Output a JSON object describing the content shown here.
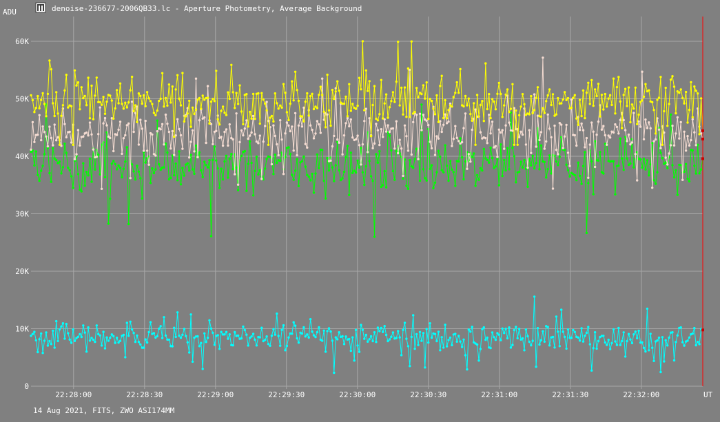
{
  "window": {
    "title": "denoise-236677-2006QB33.lc - Aperture Photometry, Average Background",
    "icon": "tiles-app-icon"
  },
  "footer": {
    "text": "14 Aug 2021, FITS, ZWO ASI174MM"
  },
  "colors": {
    "background": "#808080",
    "grid": "#a8a8a8",
    "text": "#ffffff",
    "cursor": "#ff0000",
    "series_yellow": "#ffff00",
    "series_pink": "#f5dcd2",
    "series_green": "#00ff00",
    "series_cyan": "#00ffff"
  },
  "chart_data": {
    "type": "line",
    "ylabel": "ADU",
    "xlabel": "UT",
    "ylim": [
      0,
      60000
    ],
    "y_ticks": [
      0,
      10000,
      20000,
      30000,
      40000,
      50000,
      60000
    ],
    "y_tick_labels": [
      "0",
      "10K",
      "20K",
      "30K",
      "40K",
      "50K",
      "60K"
    ],
    "xlim": [
      "22:27:42",
      "22:32:26"
    ],
    "x_ticks": [
      "22:28:00",
      "22:28:30",
      "22:29:00",
      "22:29:30",
      "22:30:00",
      "22:30:30",
      "22:31:00",
      "22:31:30",
      "22:32:00"
    ],
    "grid": true,
    "markers": true,
    "samples_per_series": 400,
    "cursor_x": "22:32:26",
    "series": [
      {
        "color": "yellow",
        "mean": 49500,
        "spread": 3800,
        "min": 42000,
        "max": 61500
      },
      {
        "color": "pink",
        "mean": 44000,
        "spread": 4500,
        "min": 30000,
        "max": 59000
      },
      {
        "color": "green",
        "mean": 38500,
        "spread": 4200,
        "min": 26000,
        "max": 49000
      },
      {
        "color": "cyan",
        "mean": 8500,
        "spread": 2200,
        "min": 1000,
        "max": 17000
      }
    ]
  }
}
